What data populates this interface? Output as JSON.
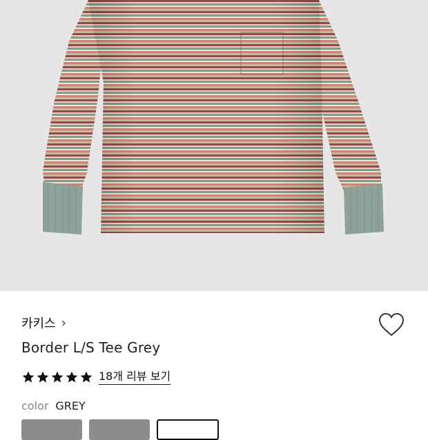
{
  "product": {
    "brand": "카키스",
    "brand_chevron_icon": "chevron-right-icon",
    "name": "Border L/S Tee Grey",
    "rating_stars": 5,
    "reviews_link": "18개 리뷰 보기",
    "color_label": "color",
    "color_value": "GREY"
  },
  "colors": {
    "hero_bg": "#e6e6e6",
    "stripe_palette": [
      "#8e4a4c",
      "#d9d8c6",
      "#7e9a8c",
      "#c7866f",
      "#b5bfa3"
    ],
    "cuff": "#8ea29a"
  },
  "icons": {
    "wishlist": "heart-outline-icon",
    "star": "star-filled-icon"
  }
}
